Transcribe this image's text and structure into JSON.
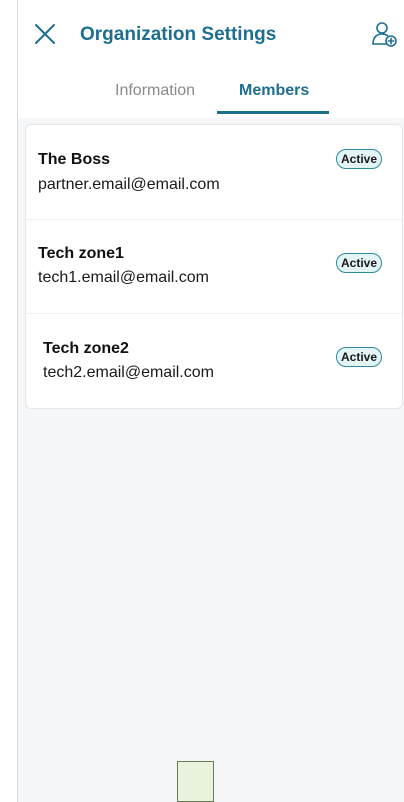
{
  "header": {
    "title": "Organization Settings",
    "close_icon": "close-icon",
    "add_member_icon": "add-user-icon"
  },
  "tabs": [
    {
      "label": "Information",
      "active": false
    },
    {
      "label": "Members",
      "active": true
    }
  ],
  "members": [
    {
      "name": "The Boss",
      "email": "partner.email@email.com",
      "status": "Active"
    },
    {
      "name": "Tech zone1",
      "email": "tech1.email@email.com",
      "status": "Active"
    },
    {
      "name": "Tech zone2",
      "email": "tech2.email@email.com",
      "status": "Active"
    }
  ],
  "colors": {
    "accent": "#1e6f8f",
    "badge_background": "#e4f3f4",
    "badge_border": "#2e8aa0",
    "content_background": "#f6f7f9"
  }
}
